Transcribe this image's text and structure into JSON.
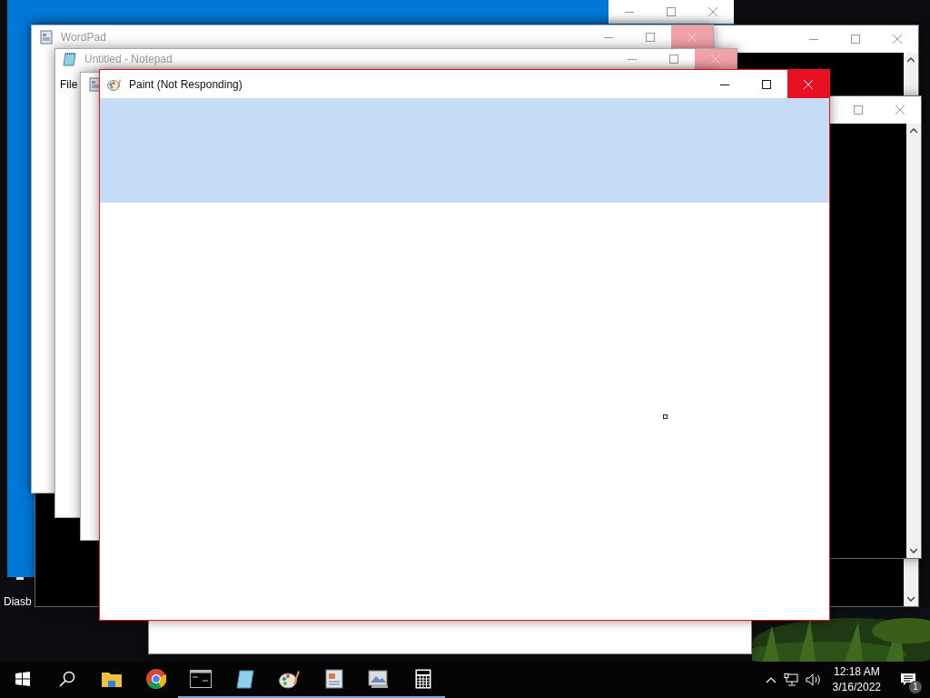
{
  "desktop_labels": [
    "Diasb"
  ],
  "windows": [
    {
      "kind": "blank",
      "active": false,
      "buttons": [
        {
          "kind": "minimize",
          "highlighted": false
        },
        {
          "kind": "maximize",
          "highlighted": false
        },
        {
          "kind": "close",
          "highlighted": false
        }
      ]
    },
    {
      "kind": "console",
      "active": false,
      "buttons": [
        {
          "kind": "minimize",
          "highlighted": false
        },
        {
          "kind": "maximize",
          "highlighted": false
        },
        {
          "kind": "close",
          "highlighted": false
        }
      ]
    },
    {
      "kind": "wordpad",
      "title": "WordPad",
      "active": false,
      "buttons": [
        {
          "kind": "minimize",
          "highlighted": false
        },
        {
          "kind": "maximize",
          "highlighted": false
        },
        {
          "kind": "close",
          "highlighted": true
        }
      ]
    },
    {
      "kind": "notepad",
      "title": "Untitled - Notepad",
      "menu": [
        "File"
      ],
      "active": false,
      "buttons": [
        {
          "kind": "minimize",
          "highlighted": false
        },
        {
          "kind": "maximize",
          "highlighted": false
        },
        {
          "kind": "close",
          "highlighted": true
        }
      ]
    },
    {
      "kind": "wordpad"
    },
    {
      "kind": "console",
      "active": false,
      "buttons": [
        {
          "kind": "maximize",
          "highlighted": false
        },
        {
          "kind": "close",
          "highlighted": false
        }
      ]
    },
    {
      "kind": "plain"
    },
    {
      "kind": "paint",
      "title": "Paint (Not Responding)",
      "active": true,
      "buttons": [
        {
          "kind": "minimize",
          "highlighted": false
        },
        {
          "kind": "maximize",
          "highlighted": false
        },
        {
          "kind": "close",
          "highlighted": true
        }
      ]
    }
  ],
  "taskbar": {
    "items": [
      {
        "kind": "start",
        "running": false
      },
      {
        "kind": "search",
        "running": false
      },
      {
        "kind": "explorer",
        "running": false
      },
      {
        "kind": "chrome",
        "running": false
      },
      {
        "kind": "cmd",
        "running": true
      },
      {
        "kind": "notepad",
        "running": true
      },
      {
        "kind": "paint",
        "running": true
      },
      {
        "kind": "wordpad",
        "running": true
      },
      {
        "kind": "viewer",
        "running": true
      },
      {
        "kind": "calculator",
        "running": true
      }
    ],
    "time": "12:18 AM",
    "date": "3/16/2022",
    "notifications": "1"
  }
}
